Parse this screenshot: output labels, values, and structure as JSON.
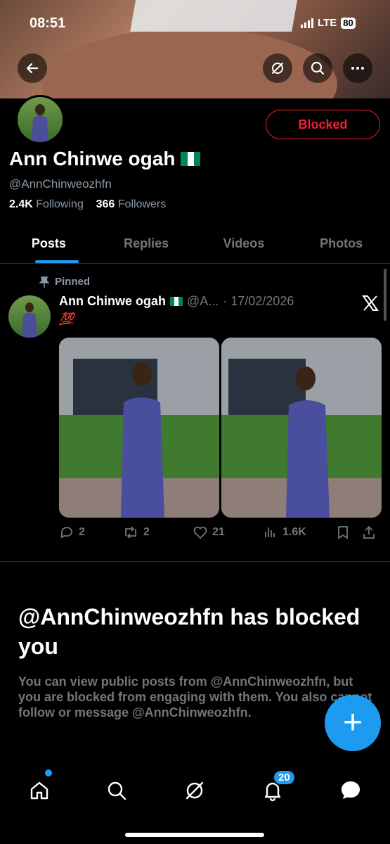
{
  "status": {
    "time": "08:51",
    "network": "LTE",
    "battery": "80"
  },
  "profile": {
    "name": "Ann Chinwe ogah",
    "handle": "@AnnChinweozhfn",
    "following_count": "2.4K",
    "following_label": "Following",
    "followers_count": "366",
    "followers_label": "Followers",
    "blocked_label": "Blocked"
  },
  "tabs": [
    "Posts",
    "Replies",
    "Videos",
    "Photos"
  ],
  "post": {
    "pinned_label": "Pinned",
    "author": "Ann Chinwe ogah",
    "handle_short": "@A...",
    "date": "· 17/02/2026",
    "text": "💯",
    "replies": "2",
    "reposts": "2",
    "likes": "21",
    "views": "1.6K"
  },
  "blocked_notice": {
    "title": "@AnnChinweozhfn has blocked you",
    "body": "You can view public posts from @AnnChinweozhfn, but you are blocked from engaging with them. You also cannot follow or message @AnnChinweozhfn."
  },
  "fab_label": "+",
  "notifications_badge": "20",
  "colors": {
    "accent": "#1d9bf0",
    "blocked": "#f4212e",
    "muted": "#71767b"
  }
}
